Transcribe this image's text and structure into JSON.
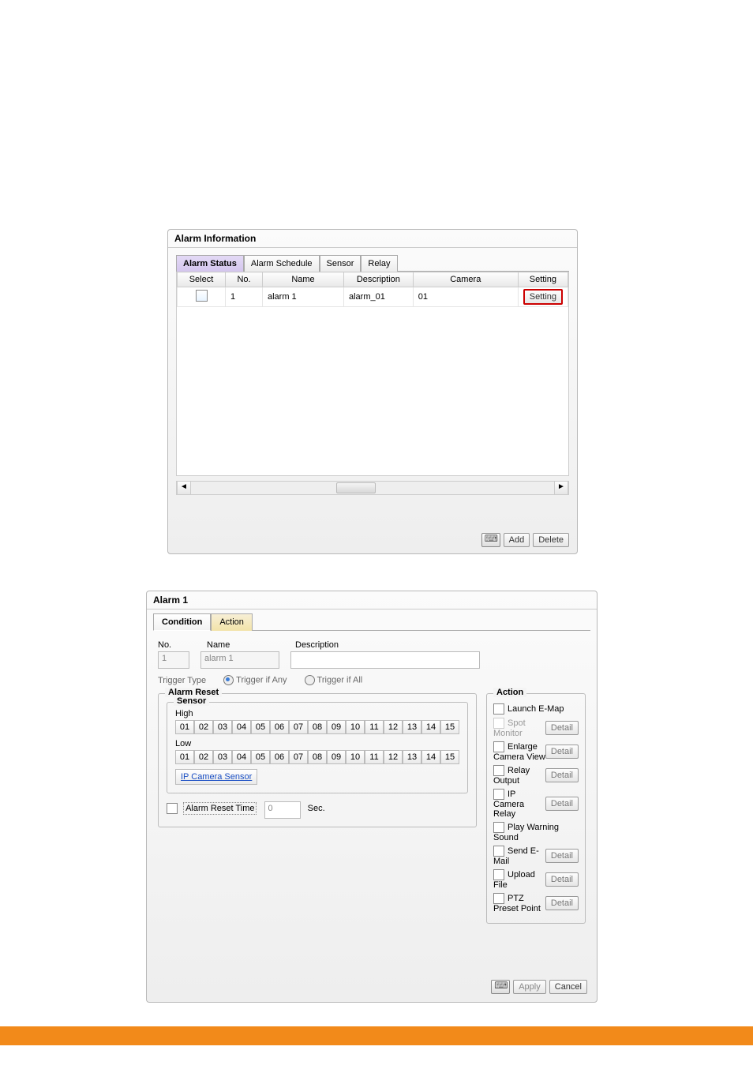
{
  "panel1": {
    "title": "Alarm Information",
    "tabs": [
      "Alarm Status",
      "Alarm Schedule",
      "Sensor",
      "Relay"
    ],
    "active_tab": 0,
    "columns": [
      "Select",
      "No.",
      "Name",
      "Description",
      "Camera",
      "Setting"
    ],
    "row": {
      "no": "1",
      "name": "alarm 1",
      "description": "alarm_01",
      "camera": "01",
      "setting_label": "Setting"
    },
    "buttons": {
      "add": "Add",
      "delete": "Delete"
    }
  },
  "panel2": {
    "title": "Alarm 1",
    "tabs": [
      "Condition",
      "Action"
    ],
    "active_tab": 0,
    "fields": {
      "no_label": "No.",
      "no_value": "1",
      "name_label": "Name",
      "name_value": "alarm 1",
      "desc_label": "Description",
      "desc_value": ""
    },
    "trigger": {
      "label": "Trigger Type",
      "opt_any": "Trigger if Any",
      "opt_all": "Trigger if All"
    },
    "alarm_reset": {
      "legend": "Alarm Reset",
      "sensor_legend": "Sensor",
      "high": "High",
      "low": "Low",
      "nums": [
        "01",
        "02",
        "03",
        "04",
        "05",
        "06",
        "07",
        "08",
        "09",
        "10",
        "11",
        "12",
        "13",
        "14",
        "15"
      ],
      "ip_sensor": "IP Camera Sensor",
      "reset_time_label": "Alarm Reset Time",
      "reset_time_value": "0",
      "reset_time_unit": "Sec."
    },
    "action": {
      "legend": "Action",
      "items": [
        {
          "label": "Launch E-Map",
          "detail": false,
          "muted": false
        },
        {
          "label": "Spot Monitor",
          "detail": true,
          "muted": true
        },
        {
          "label": "Enlarge Camera View",
          "detail": true,
          "muted": false
        },
        {
          "label": "Relay Output",
          "detail": true,
          "muted": false
        },
        {
          "label": "IP Camera Relay",
          "detail": true,
          "muted": false
        },
        {
          "label": "Play Warning Sound",
          "detail": false,
          "muted": false
        },
        {
          "label": "Send E-Mail",
          "detail": true,
          "muted": false
        },
        {
          "label": "Upload File",
          "detail": true,
          "muted": false
        },
        {
          "label": "PTZ Preset Point",
          "detail": true,
          "muted": false
        }
      ],
      "detail_label": "Detail"
    },
    "footer": {
      "apply": "Apply",
      "cancel": "Cancel"
    }
  }
}
